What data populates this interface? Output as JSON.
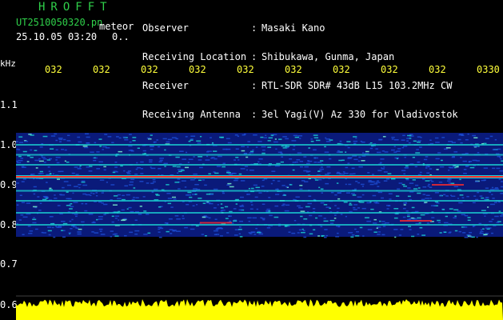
{
  "brand": "HROFFT",
  "file": {
    "name": "UT2510050320.pn",
    "mode": "meteor",
    "datetime": "25.10.05 03:20",
    "extra": "0.."
  },
  "header": {
    "rows": [
      {
        "label": "Observer",
        "value": "Masaki Kano"
      },
      {
        "label": "Receiving Location",
        "value": "Shibukawa, Gunma, Japan"
      },
      {
        "label": "Receiver",
        "value": "RTL-SDR SDR# 43dB L15 103.2MHz CW"
      },
      {
        "label": "Receiving Antenna",
        "value": "3el Yagi(V) Az 330 for Vladivostok"
      }
    ],
    "separator": ":"
  },
  "time_axis": {
    "labels": [
      "032",
      "032",
      "032",
      "032",
      "032",
      "032",
      "032",
      "032",
      "032",
      "0330"
    ]
  },
  "freq_axis": {
    "unit": "kHz",
    "labels": [
      "1.1",
      "1.0",
      "0.9",
      "0.8",
      "0.7",
      "0.6"
    ],
    "values": [
      1.1,
      1.0,
      0.9,
      0.8,
      0.7,
      0.6
    ]
  },
  "colors": {
    "text": "#ffffff",
    "brand": "#2fd04a",
    "time_labels": "#ffff3a",
    "level": "#ffff00",
    "background": "#000000",
    "bands": [
      "#0a1a7a",
      "#1d4fd6",
      "#1bd4d4",
      "#ff2a2a"
    ]
  },
  "spectrogram": {
    "signal_band_khz": [
      0.77,
      1.03
    ],
    "strong_line_khz": 0.92,
    "secondary_lines_khz": [
      1.0,
      0.975,
      0.95,
      0.885,
      0.86,
      0.83,
      0.8
    ]
  }
}
